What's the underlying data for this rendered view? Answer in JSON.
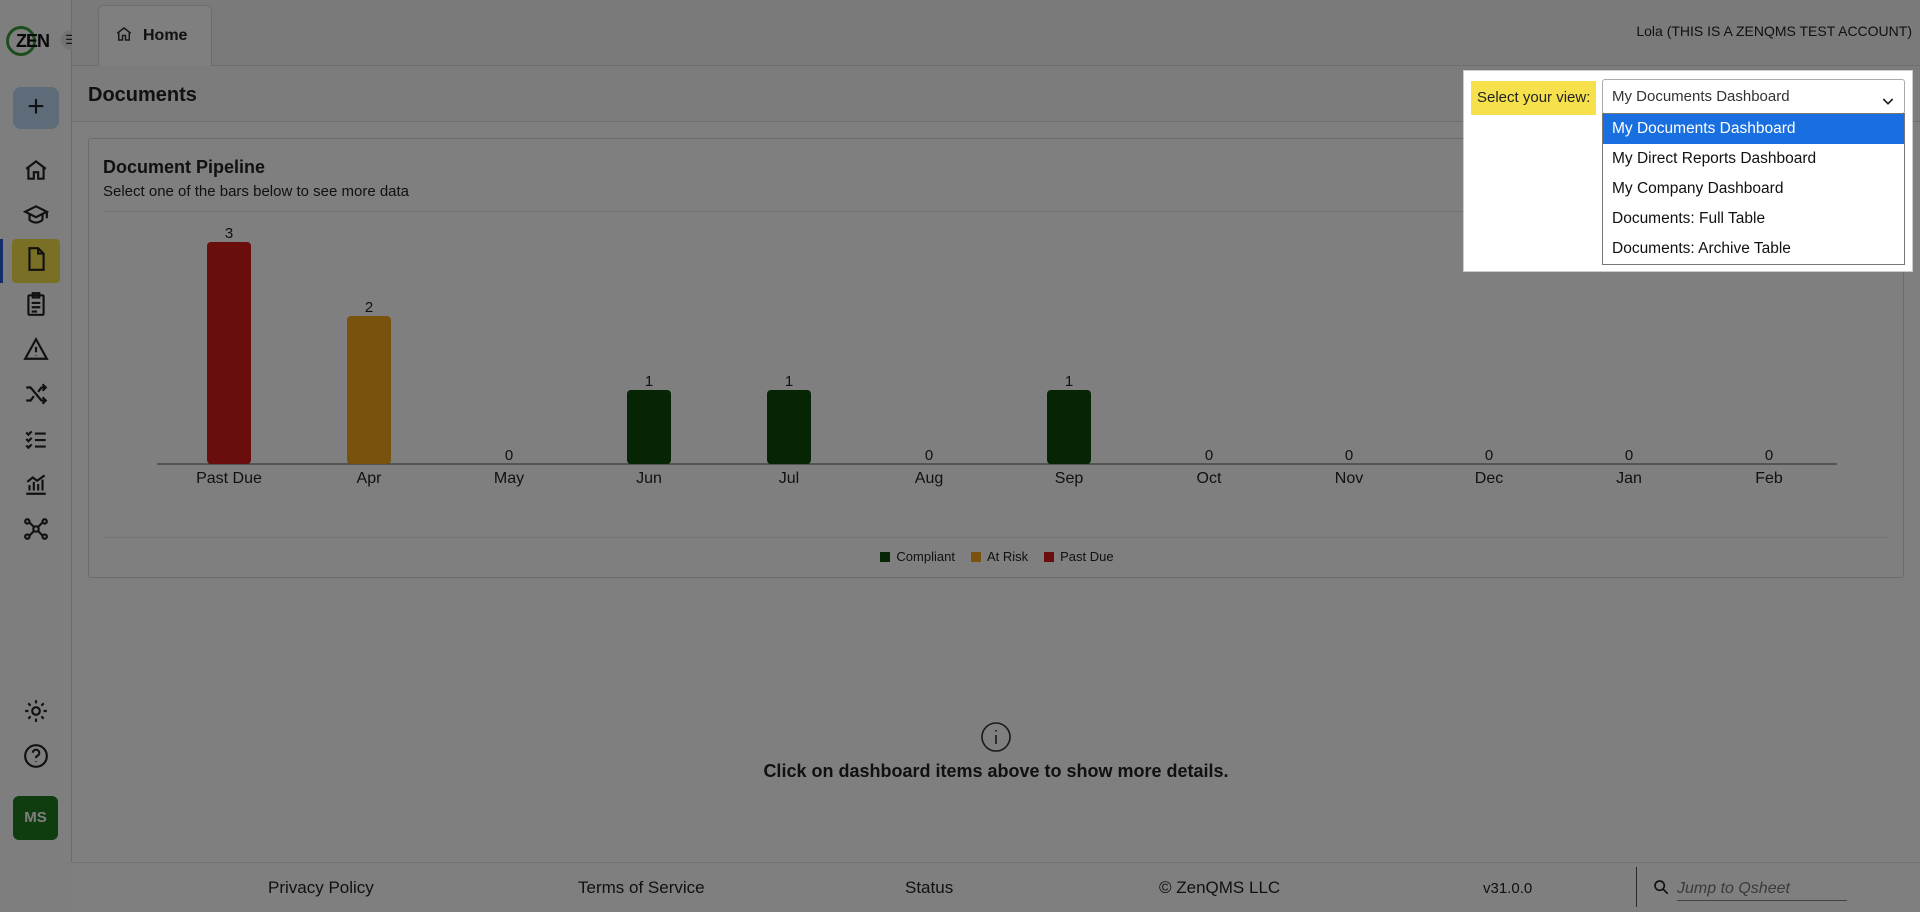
{
  "logo": {
    "text": "ZEN"
  },
  "sidebar": {
    "avatar_initials": "MS",
    "accent": "#f4e04a"
  },
  "topbar": {
    "tab_home": "Home",
    "user": "Lola (THIS IS A ZENQMS TEST ACCOUNT)"
  },
  "page": {
    "title": "Documents"
  },
  "card": {
    "title": "Document Pipeline",
    "subtitle": "Select one of the bars below to see more data"
  },
  "chart_data": {
    "type": "bar",
    "categories": [
      "Past Due",
      "Apr",
      "May",
      "Jun",
      "Jul",
      "Aug",
      "Sep",
      "Oct",
      "Nov",
      "Dec",
      "Jan",
      "Feb"
    ],
    "values": [
      3,
      2,
      0,
      1,
      1,
      0,
      1,
      0,
      0,
      0,
      0,
      0
    ],
    "bar_status": [
      "Past Due",
      "At Risk",
      "Compliant",
      "Compliant",
      "Compliant",
      "Compliant",
      "Compliant",
      "Compliant",
      "Compliant",
      "Compliant",
      "Compliant",
      "Compliant"
    ],
    "legend": [
      {
        "name": "Compliant",
        "color": "#0b4a0b"
      },
      {
        "name": "At Risk",
        "color": "#f2a51a"
      },
      {
        "name": "Past Due",
        "color": "#d41a1a"
      }
    ],
    "ylim": [
      0,
      3
    ],
    "grid": false,
    "legend_position": "bottom"
  },
  "hint": {
    "text": "Click on dashboard items above to show more details."
  },
  "footer": {
    "privacy": "Privacy Policy",
    "terms": "Terms of Service",
    "status": "Status",
    "copyright": "© ZenQMS LLC",
    "version": "v31.0.0",
    "jump_placeholder": "Jump to Qsheet"
  },
  "view_selector": {
    "label": "Select your view:",
    "selected": "My Documents Dashboard",
    "options": [
      "My Documents Dashboard",
      "My Direct Reports Dashboard",
      "My Company Dashboard",
      "Documents: Full Table",
      "Documents: Archive Table"
    ]
  }
}
